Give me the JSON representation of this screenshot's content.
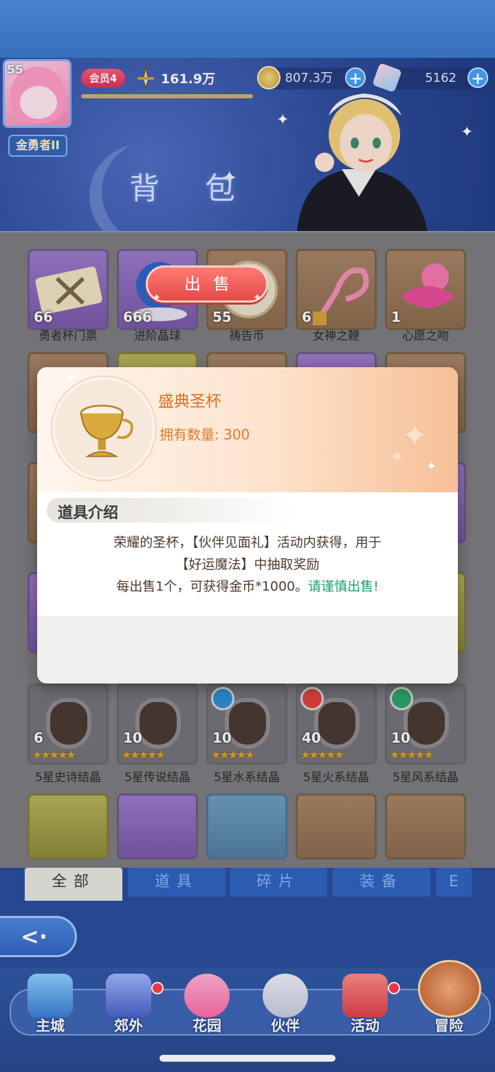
{
  "player": {
    "level": "55",
    "rank_title": "金勇者II",
    "vip": "会员4",
    "power": "161.9万"
  },
  "currency": {
    "gold": "807.3万",
    "gems": "5162"
  },
  "page_title": "背 包",
  "items_row1": [
    {
      "name": "勇者杯门票",
      "qty": "66"
    },
    {
      "name": "进阶晶球",
      "qty": "666"
    },
    {
      "name": "祷告币",
      "qty": "55"
    },
    {
      "name": "女神之鞭",
      "qty": "6"
    },
    {
      "name": "心愿之吻",
      "qty": "1"
    }
  ],
  "items_row6": [
    {
      "name": "5星史诗结晶",
      "qty": "6"
    },
    {
      "name": "5星传说结晶",
      "qty": "10"
    },
    {
      "name": "5星水系结晶",
      "qty": "10"
    },
    {
      "name": "5星火系结晶",
      "qty": "40"
    },
    {
      "name": "5星风系结晶",
      "qty": "10"
    }
  ],
  "tabs": [
    "全部",
    "道具",
    "碎片",
    "装备",
    "E"
  ],
  "nav": [
    "主城",
    "郊外",
    "花园",
    "伙伴",
    "活动",
    "冒险"
  ],
  "dialog": {
    "item_name": "盛典圣杯",
    "owned_label": "拥有数量:",
    "owned_value": "300",
    "section_title": "道具介绍",
    "desc_line1": "荣耀的圣杯，【伙伴见面礼】活动内获得，用于",
    "desc_line2": "【好运魔法】中抽取奖励",
    "desc_line3": "每出售1个，可获得金币*1000。",
    "warning": "请谨慎出售!",
    "sell_button": "出售"
  },
  "icons": [
    "back-icon",
    "plus-icon",
    "gold-coin-icon",
    "gem-icon",
    "power-sword-icon",
    "chalice-icon"
  ]
}
